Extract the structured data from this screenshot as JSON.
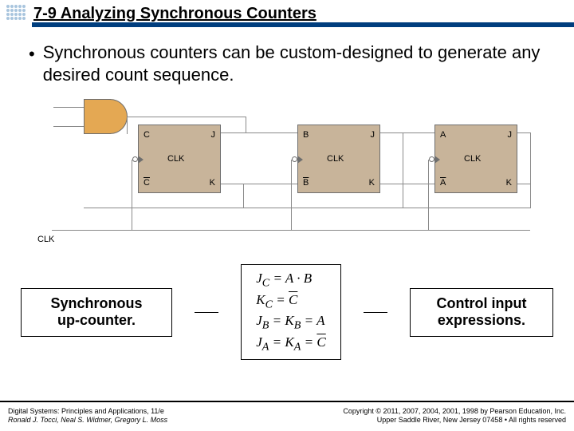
{
  "header": {
    "section": "7-9  Analyzing Synchronous Counters"
  },
  "bullet": {
    "text": "Synchronous counters can be custom-designed to generate any desired count sequence."
  },
  "diagram": {
    "clk": "CLK",
    "ff": [
      {
        "q": "C",
        "qb": "C",
        "j": "J",
        "k": "K",
        "clk": "CLK"
      },
      {
        "q": "B",
        "qb": "B",
        "j": "J",
        "k": "K",
        "clk": "CLK"
      },
      {
        "q": "A",
        "qb": "A",
        "j": "J",
        "k": "K",
        "clk": "CLK"
      }
    ]
  },
  "captions": {
    "left_l1": "Synchronous",
    "left_l2": "up-counter.",
    "right_l1": "Control input",
    "right_l2": "expressions."
  },
  "equations": {
    "r1": {
      "lhs": "J",
      "sub": "C",
      "rhs": "A · B"
    },
    "r2": {
      "lhs": "K",
      "sub": "C",
      "rhs_over": "C"
    },
    "r3": {
      "l1": "J",
      "s1": "B",
      "l2": "K",
      "s2": "B",
      "rhs": "A"
    },
    "r4": {
      "l1": "J",
      "s1": "A",
      "l2": "K",
      "s2": "A",
      "rhs_over": "C"
    }
  },
  "footer": {
    "left_l1": "Digital Systems: Principles and Applications, 11/e",
    "left_l2": "Ronald J. Tocci, Neal S. Widmer, Gregory L. Moss",
    "right_l1": "Copyright © 2011, 2007, 2004, 2001, 1998 by Pearson Education, Inc.",
    "right_l2": "Upper Saddle River, New Jersey 07458 • All rights reserved"
  }
}
